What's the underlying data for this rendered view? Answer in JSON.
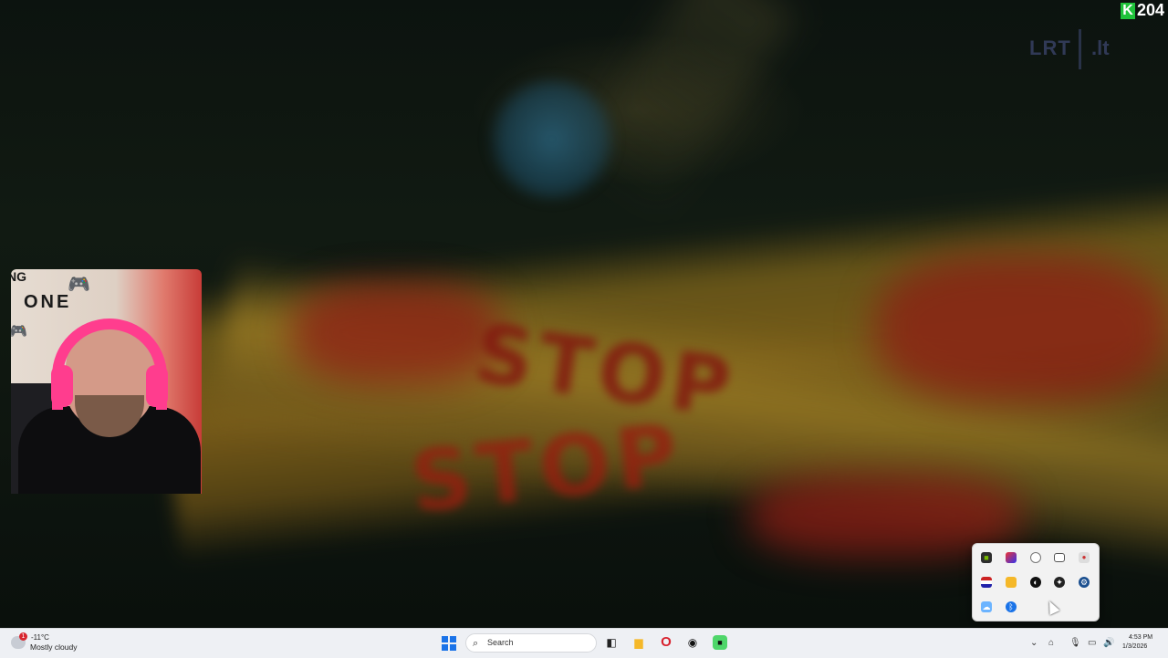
{
  "overlay": {
    "channel_badge": "K",
    "channel_number": "204",
    "watermark_left": "LRT",
    "watermark_right": ".lt"
  },
  "scene": {
    "tape_text_1": "STOP",
    "tape_text_2": "STOP"
  },
  "webcam": {
    "wall_text_top": "NG",
    "wall_text": "ONE"
  },
  "taskbar": {
    "weather_badge": "1",
    "weather_temp": "-11°C",
    "weather_desc": "Mostly cloudy",
    "search_placeholder": "Search",
    "clock_time": "4:53 PM",
    "clock_date": "1/3/2026"
  },
  "tray_icons": [
    "nvidia-icon",
    "color-app-icon",
    "radar-icon",
    "gamepad-icon",
    "discord-icon",
    "flag-icon",
    "folder-icon",
    "circle-app-icon",
    "target-icon",
    "steam-icon",
    "cloud-icon",
    "bluetooth-icon"
  ]
}
